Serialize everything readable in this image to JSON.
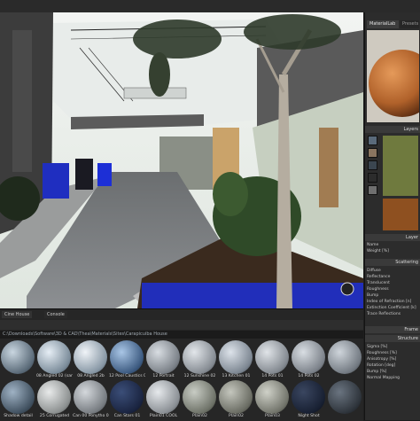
{
  "panel": {
    "tabs": [
      "MaterialLab",
      "Presets"
    ],
    "sections": {
      "layers": "Layers",
      "layer": "Layer",
      "scattering": "Scattering",
      "frame": "Frame",
      "structure": "Structure"
    },
    "layer_rows": [
      "Name",
      "Weight [%]"
    ],
    "scatter_rows": [
      "Diffuse",
      "Reflectance",
      "Translucent",
      "Roughness",
      "Bump",
      "Index of Refraction [n]",
      "Extinction Coefficient [k]",
      "Trace Reflections"
    ],
    "structure_rows": [
      "Sigma [%]",
      "Roughness [%]",
      "Anisotropy [%]",
      "Rotation [deg]",
      "Bump [%]",
      "Normal Mapping"
    ]
  },
  "browser": {
    "tabs": [
      "Cine House",
      "Console"
    ],
    "path": "C:\\Downloads\\Software\\3D & CAD\\Thea\\Materials\\Sites\\Carapicuiba House",
    "row1": [
      "",
      "",
      "",
      "",
      "",
      "",
      "",
      "",
      "",
      "",
      ""
    ],
    "row2": [
      "Shadow detail",
      "25 Corrugated",
      "Can 00 Ponytho 01",
      "Can Stars 01",
      "Plain01 COOL",
      "Plain02",
      "Plain02",
      "Plain03",
      "Night Shot",
      "",
      ""
    ],
    "row1_labels": [
      "",
      "08 Angled 02 (sane)",
      "08 Angled 2b",
      "12 Pool Caustics 02",
      "12 Portrait",
      "12 Sunshine 02",
      "13 Kitchen 01",
      "14 Pots 01",
      "14 Pots 02",
      "",
      ""
    ]
  },
  "colors": {
    "sphere": "#b0612a",
    "accent_blue": "#1d2fd6",
    "tree": "#2f4a28"
  }
}
